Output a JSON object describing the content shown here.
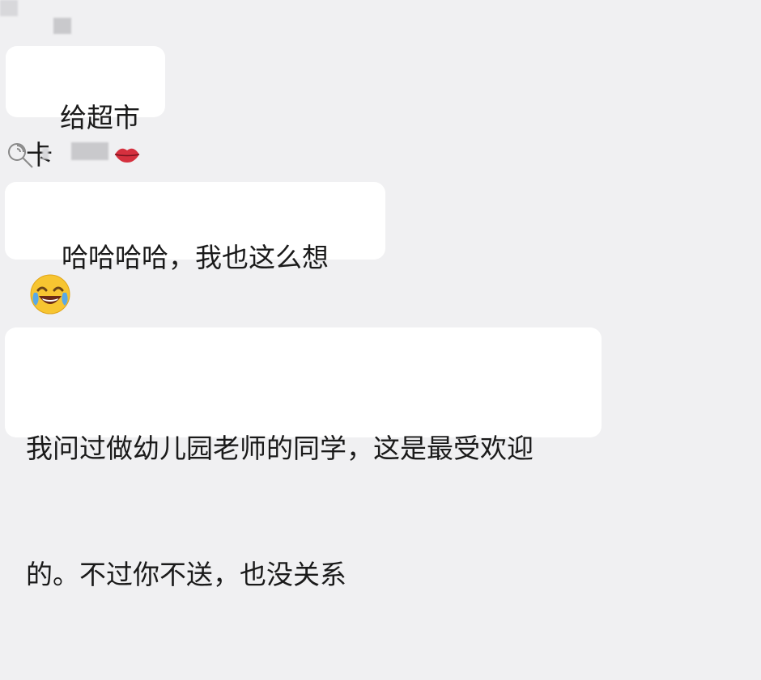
{
  "messages": [
    {
      "text": "给超市卡"
    },
    {
      "text": "哈哈哈哈，我也这么想",
      "emoji": "laughing-crying-emoji"
    },
    {
      "line1": "我问过做幼儿园老师的同学，这是最受欢迎",
      "line2": "的。不过你不送，也没关系"
    }
  ],
  "icons": {
    "sender2_avatar": "lollipop-icon",
    "sender2_name_suffix": "lips-icon"
  },
  "colors": {
    "background": "#f0f0f2",
    "bubble": "#ffffff",
    "text": "#1a1a1a"
  }
}
